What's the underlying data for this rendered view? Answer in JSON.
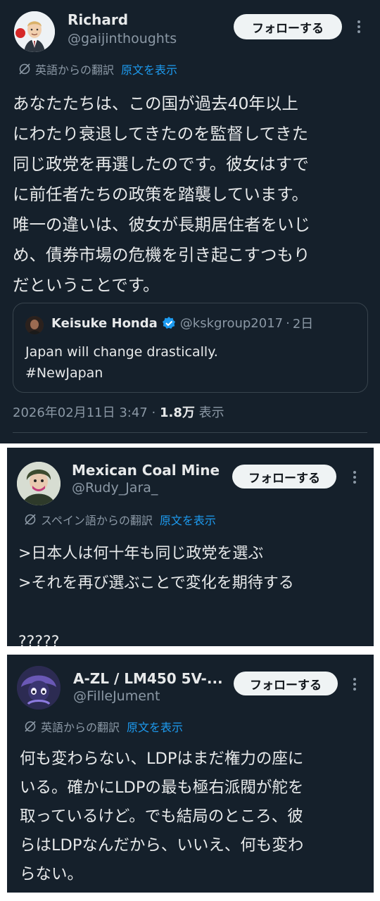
{
  "translation_icon": "no-translate-icon",
  "accent_color": "#1d9bf0",
  "post1": {
    "name": "Richard",
    "handle": "@gaijinthoughts",
    "follow_label": "フォローする",
    "translation_label": "英語からの翻訳",
    "show_original_label": "原文を表示",
    "body_lines": [
      "あなたたちは、この国が過去40年以上",
      "にわたり衰退してきたのを監督してきた",
      "同じ政党を再選したのです。彼女はすで",
      "に前任者たちの政策を踏襲しています。",
      "唯一の違いは、彼女が長期居住者をいじ",
      "め、債券市場の危機を引き起こすつもり",
      "だということです。"
    ],
    "quote": {
      "name": "Keisuke Honda",
      "handle": "@kskgroup2017",
      "separator": "·",
      "time": "2日",
      "lines": [
        "Japan will change drastically.",
        "#NewJapan"
      ]
    },
    "meta": {
      "timestamp": "2026年02月11日 3:47",
      "separator": "·",
      "views": "1.8万",
      "views_label": "表示"
    }
  },
  "post2": {
    "name": "Mexican Coal Mine",
    "handle": "@Rudy_Jara_",
    "follow_label": "フォローする",
    "translation_label": "スペイン語からの翻訳",
    "show_original_label": "原文を表示",
    "body_lines": [
      ">日本人は何十年も同じ政党を選ぶ",
      ">それを再び選ぶことで変化を期待する",
      "",
      "?????"
    ]
  },
  "post3": {
    "name": "A-ZL / LM450 5V-...",
    "handle": "@FilleJument",
    "follow_label": "フォローする",
    "translation_label": "英語からの翻訳",
    "show_original_label": "原文を表示",
    "body_lines": [
      "何も変わらない、LDPはまだ権力の座に",
      "いる。確かにLDPの最も極右派閥が舵を",
      "取っているけど。でも結局のところ、彼",
      "らはLDPなんだから、いいえ、何も変わ",
      "らない。"
    ]
  }
}
